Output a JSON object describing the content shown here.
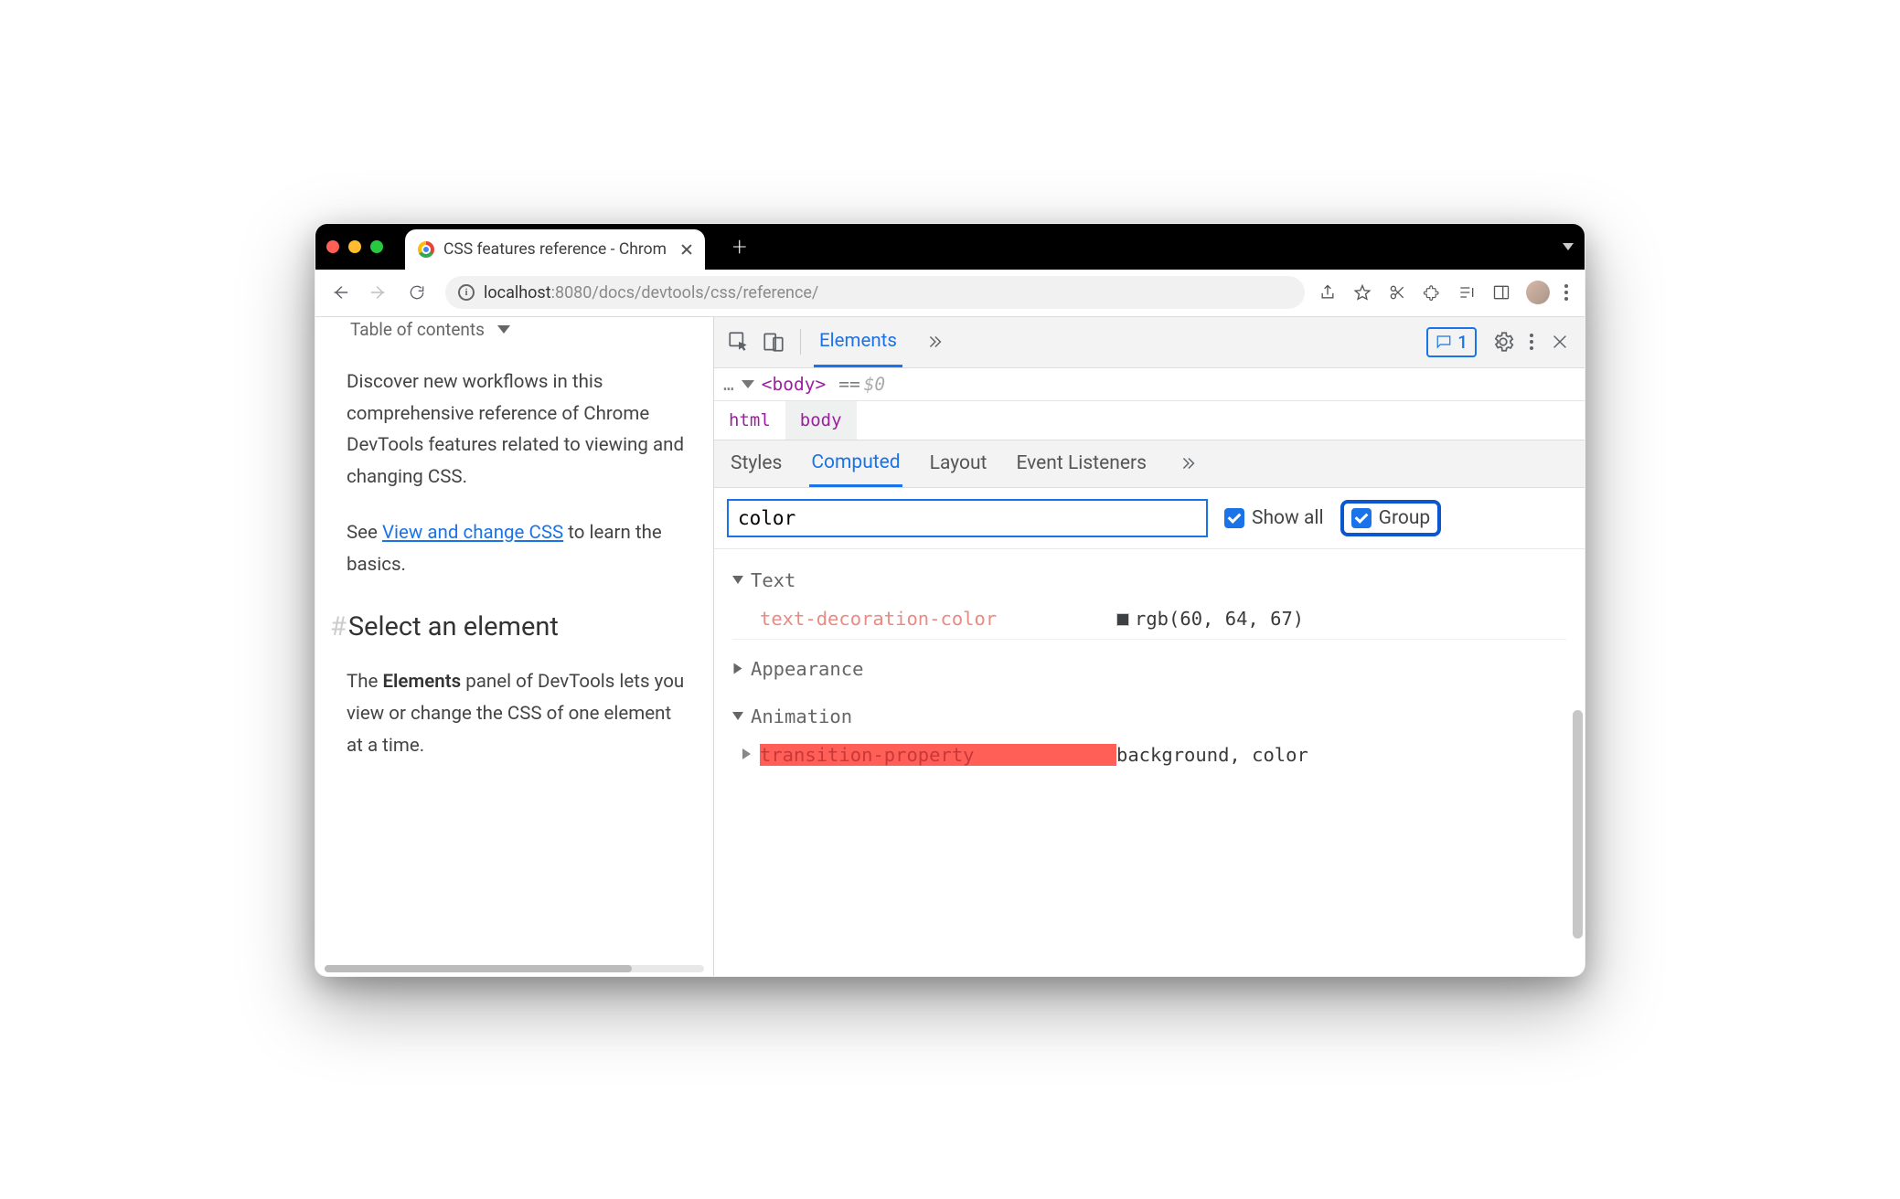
{
  "browser": {
    "tab_title": "CSS features reference - Chrom",
    "url": {
      "host": "localhost",
      "port": ":8080",
      "path": "/docs/devtools/css/reference/"
    }
  },
  "page": {
    "toc_label": "Table of contents",
    "intro": "Discover new workflows in this comprehensive reference of Chrome DevTools features related to viewing and changing CSS.",
    "see_prefix": "See ",
    "link_text": "View and change CSS",
    "see_suffix": " to learn the basics.",
    "heading": "Select an element",
    "body_prefix": "The ",
    "body_bold": "Elements",
    "body_suffix": " panel of DevTools lets you view or change the CSS of one element at a time."
  },
  "devtools": {
    "main_tabs": {
      "active": "Elements"
    },
    "issues_count": "1",
    "dom": {
      "tag": "<body>",
      "eq": "==",
      "d0": "$0",
      "ellipsis": "…"
    },
    "breadcrumbs": [
      "html",
      "body"
    ],
    "panel_tabs": [
      "Styles",
      "Computed",
      "Layout",
      "Event Listeners"
    ],
    "panel_active": "Computed",
    "filter_value": "color",
    "show_all_label": "Show all",
    "group_label": "Group",
    "groups": {
      "g1": "Text",
      "g2": "Appearance",
      "g3": "Animation"
    },
    "props": {
      "p1_name": "text-decoration-color",
      "p1_val": "rgb(60, 64, 67)",
      "p2_name": "transition-property",
      "p2_val": "background, color"
    }
  }
}
